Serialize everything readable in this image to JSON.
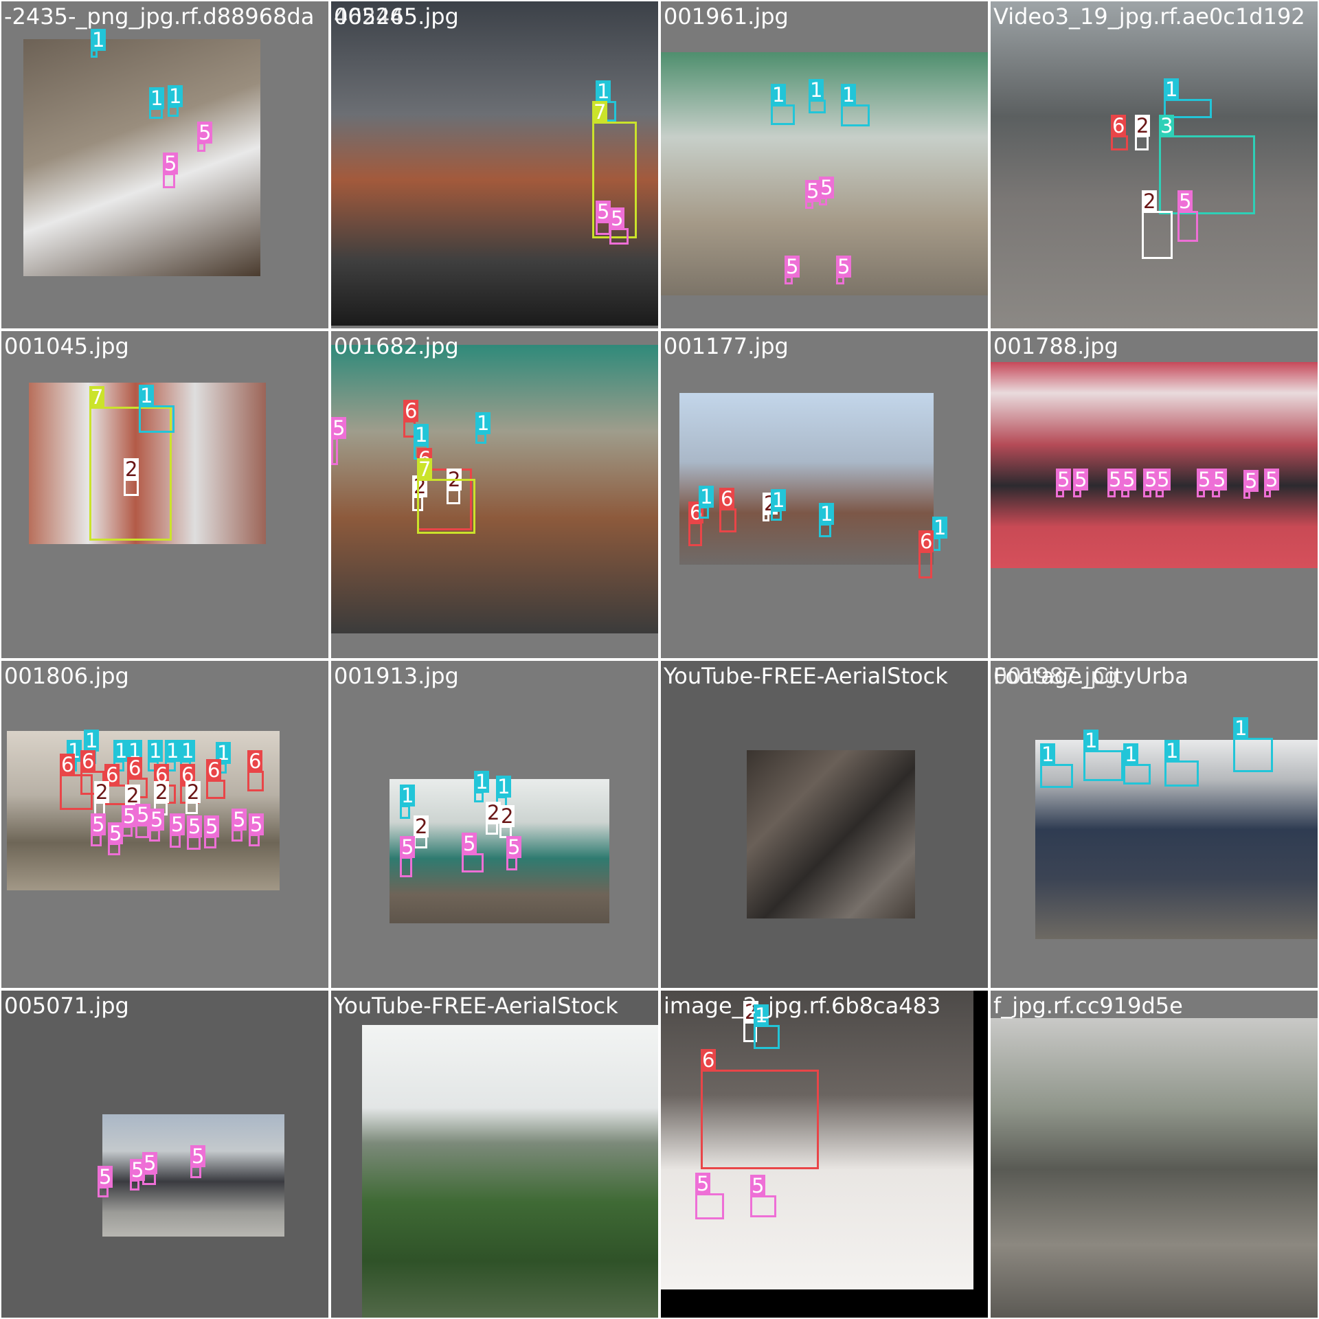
{
  "tiles": [
    {
      "label": "-2435-_png_jpg.rf.d88968da",
      "bg": "#7a7a7a",
      "photo": {
        "bg": "linear-gradient(160deg,#6d6256 0%,#9a8e7e 40%,#e9e9e9 60%,#4a3b2e 100%)"
      },
      "boxes": [
        {
          "cls": "1",
          "color": "#22c5d8",
          "text": "#ffffff"
        },
        {
          "cls": "1",
          "color": "#22c5d8",
          "text": "#ffffff"
        },
        {
          "cls": "1",
          "color": "#22c5d8",
          "text": "#ffffff"
        },
        {
          "cls": "5",
          "color": "#ee6fd6",
          "text": "#ffffff"
        },
        {
          "cls": "5",
          "color": "#ee6fd6",
          "text": "#ffffff"
        }
      ]
    },
    {
      "label": "005265.jpg",
      "bg": "#7a7a7a",
      "label2": "46244",
      "photo": {
        "bg": "linear-gradient(180deg,#3c4148 0%,#6c6f74 35%,#a35a3c 55%,#3f3f3f 80%,#1b1b1b 100%)"
      },
      "boxes": [
        {
          "cls": "1",
          "color": "#22c5d8",
          "text": "#ffffff"
        },
        {
          "cls": "7",
          "color": "#cbe32b",
          "text": "#ffffff"
        },
        {
          "cls": "5",
          "color": "#ee6fd6",
          "text": "#ffffff"
        },
        {
          "cls": "5",
          "color": "#ee6fd6",
          "text": "#ffffff"
        }
      ]
    },
    {
      "label": "001961.jpg",
      "bg": "#7a7a7a",
      "photo": {
        "bg": "linear-gradient(180deg,#4f8f6e 0%,#c7cfc9 35%,#a59a88 70%,#7c7468 100%)"
      },
      "boxes": [
        {
          "cls": "1",
          "color": "#22c5d8",
          "text": "#ffffff"
        },
        {
          "cls": "1",
          "color": "#22c5d8",
          "text": "#ffffff"
        },
        {
          "cls": "1",
          "color": "#22c5d8",
          "text": "#ffffff"
        },
        {
          "cls": "5",
          "color": "#ee6fd6",
          "text": "#ffffff"
        },
        {
          "cls": "5",
          "color": "#ee6fd6",
          "text": "#ffffff"
        },
        {
          "cls": "5",
          "color": "#ee6fd6",
          "text": "#ffffff"
        },
        {
          "cls": "5",
          "color": "#ee6fd6",
          "text": "#ffffff"
        }
      ]
    },
    {
      "label": "Video3_19_jpg.rf.ae0c1d192",
      "bg": "#7a7a7a",
      "photo": {
        "bg": "linear-gradient(180deg,#9ea4a7 0%,#5b5f60 35%,#7a7775 60%,#8c8985 100%)"
      },
      "boxes": [
        {
          "cls": "1",
          "color": "#22c5d8",
          "text": "#ffffff"
        },
        {
          "cls": "3",
          "color": "#2ed0b7",
          "text": "#ffffff"
        },
        {
          "cls": "6",
          "color": "#e94548",
          "text": "#ffffff"
        },
        {
          "cls": "2",
          "color": "#ffffff",
          "text": "#6a1616"
        },
        {
          "cls": "2",
          "color": "#ffffff",
          "text": "#6a1616"
        },
        {
          "cls": "5",
          "color": "#ee6fd6",
          "text": "#ffffff"
        },
        {
          "cls": "5",
          "color": "#ee6fd6",
          "text": "#ffffff"
        }
      ]
    },
    {
      "label": "001045.jpg",
      "bg": "#7a7a7a",
      "photo": {
        "bg": "linear-gradient(90deg,#b86f5b 0%,#e6e6e6 25%,#b35a47 45%,#dedede 70%,#9c6457 100%)"
      },
      "boxes": [
        {
          "cls": "7",
          "color": "#cbe32b",
          "text": "#ffffff"
        },
        {
          "cls": "1",
          "color": "#22c5d8",
          "text": "#ffffff"
        },
        {
          "cls": "2",
          "color": "#ffffff",
          "text": "#6a1616"
        }
      ]
    },
    {
      "label": "001682.jpg",
      "bg": "#7a7a7a",
      "photo": {
        "bg": "linear-gradient(180deg,#2f8a7a 0%,#9f9d8c 30%,#8d5a3c 60%,#3b3b3b 100%)"
      },
      "boxes": [
        {
          "cls": "5",
          "color": "#ee6fd6",
          "text": "#ffffff"
        },
        {
          "cls": "6",
          "color": "#e94548",
          "text": "#ffffff"
        },
        {
          "cls": "1",
          "color": "#22c5d8",
          "text": "#ffffff"
        },
        {
          "cls": "1",
          "color": "#22c5d8",
          "text": "#ffffff"
        },
        {
          "cls": "6",
          "color": "#e94548",
          "text": "#ffffff"
        },
        {
          "cls": "2",
          "color": "#ffffff",
          "text": "#6a1616"
        },
        {
          "cls": "2",
          "color": "#ffffff",
          "text": "#6a1616"
        },
        {
          "cls": "7",
          "color": "#cbe32b",
          "text": "#ffffff"
        }
      ]
    },
    {
      "label": "001177.jpg",
      "bg": "#7a7a7a",
      "photo": {
        "bg": "linear-gradient(180deg,#c3d6ea 0%,#aab8c8 40%,#7c5747 70%,#6f6b69 100%)"
      },
      "boxes": [
        {
          "cls": "6",
          "color": "#e94548",
          "text": "#ffffff"
        },
        {
          "cls": "1",
          "color": "#22c5d8",
          "text": "#ffffff"
        },
        {
          "cls": "6",
          "color": "#e94548",
          "text": "#ffffff"
        },
        {
          "cls": "2",
          "color": "#ffffff",
          "text": "#6a1616"
        },
        {
          "cls": "1",
          "color": "#22c5d8",
          "text": "#ffffff"
        },
        {
          "cls": "1",
          "color": "#22c5d8",
          "text": "#ffffff"
        },
        {
          "cls": "1",
          "color": "#22c5d8",
          "text": "#ffffff"
        },
        {
          "cls": "6",
          "color": "#e94548",
          "text": "#ffffff"
        }
      ]
    },
    {
      "label": "001788.jpg",
      "bg": "#7a7a7a",
      "photo": {
        "bg": "linear-gradient(180deg,#c6495a 0%,#e9dbdd 15%,#b54b57 40%,#2c2a2f 60%,#c94a55 80%,#d6505b 100%)"
      },
      "boxes": [
        {
          "cls": "5",
          "color": "#ee6fd6",
          "text": "#ffffff"
        },
        {
          "cls": "5",
          "color": "#ee6fd6",
          "text": "#ffffff"
        },
        {
          "cls": "5",
          "color": "#ee6fd6",
          "text": "#ffffff"
        },
        {
          "cls": "5",
          "color": "#ee6fd6",
          "text": "#ffffff"
        },
        {
          "cls": "5",
          "color": "#ee6fd6",
          "text": "#ffffff"
        },
        {
          "cls": "5",
          "color": "#ee6fd6",
          "text": "#ffffff"
        },
        {
          "cls": "5",
          "color": "#ee6fd6",
          "text": "#ffffff"
        },
        {
          "cls": "5",
          "color": "#ee6fd6",
          "text": "#ffffff"
        },
        {
          "cls": "5",
          "color": "#ee6fd6",
          "text": "#ffffff"
        },
        {
          "cls": "5",
          "color": "#ee6fd6",
          "text": "#ffffff"
        }
      ]
    },
    {
      "label": "001806.jpg",
      "bg": "#7a7a7a",
      "photo": {
        "bg": "linear-gradient(180deg,#d9d2c8 0%,#b8b1a6 40%,#6e6657 70%,#a29887 100%)"
      },
      "boxes": [
        {
          "cls": "1",
          "color": "#22c5d8",
          "text": "#ffffff"
        },
        {
          "cls": "1",
          "color": "#22c5d8",
          "text": "#ffffff"
        },
        {
          "cls": "1",
          "color": "#22c5d8",
          "text": "#ffffff"
        },
        {
          "cls": "1",
          "color": "#22c5d8",
          "text": "#ffffff"
        },
        {
          "cls": "1",
          "color": "#22c5d8",
          "text": "#ffffff"
        },
        {
          "cls": "1",
          "color": "#22c5d8",
          "text": "#ffffff"
        },
        {
          "cls": "1",
          "color": "#22c5d8",
          "text": "#ffffff"
        },
        {
          "cls": "1",
          "color": "#22c5d8",
          "text": "#ffffff"
        },
        {
          "cls": "6",
          "color": "#e94548",
          "text": "#ffffff"
        },
        {
          "cls": "6",
          "color": "#e94548",
          "text": "#ffffff"
        },
        {
          "cls": "6",
          "color": "#e94548",
          "text": "#ffffff"
        },
        {
          "cls": "6",
          "color": "#e94548",
          "text": "#ffffff"
        },
        {
          "cls": "6",
          "color": "#e94548",
          "text": "#ffffff"
        },
        {
          "cls": "6",
          "color": "#e94548",
          "text": "#ffffff"
        },
        {
          "cls": "6",
          "color": "#e94548",
          "text": "#ffffff"
        },
        {
          "cls": "6",
          "color": "#e94548",
          "text": "#ffffff"
        },
        {
          "cls": "2",
          "color": "#ffffff",
          "text": "#6a1616"
        },
        {
          "cls": "2",
          "color": "#ffffff",
          "text": "#6a1616"
        },
        {
          "cls": "2",
          "color": "#ffffff",
          "text": "#6a1616"
        },
        {
          "cls": "2",
          "color": "#ffffff",
          "text": "#6a1616"
        },
        {
          "cls": "5",
          "color": "#ee6fd6",
          "text": "#ffffff"
        },
        {
          "cls": "5",
          "color": "#ee6fd6",
          "text": "#ffffff"
        },
        {
          "cls": "5",
          "color": "#ee6fd6",
          "text": "#ffffff"
        },
        {
          "cls": "5",
          "color": "#ee6fd6",
          "text": "#ffffff"
        },
        {
          "cls": "5",
          "color": "#ee6fd6",
          "text": "#ffffff"
        },
        {
          "cls": "5",
          "color": "#ee6fd6",
          "text": "#ffffff"
        },
        {
          "cls": "5",
          "color": "#ee6fd6",
          "text": "#ffffff"
        },
        {
          "cls": "5",
          "color": "#ee6fd6",
          "text": "#ffffff"
        },
        {
          "cls": "5",
          "color": "#ee6fd6",
          "text": "#ffffff"
        },
        {
          "cls": "5",
          "color": "#ee6fd6",
          "text": "#ffffff"
        }
      ]
    },
    {
      "label": "001913.jpg",
      "bg": "#7a7a7a",
      "photo": {
        "bg": "linear-gradient(180deg,#e9eceb 0%,#cdd4d1 30%,#2f7b70 55%,#6f6458 80%,#5e554b 100%)"
      },
      "boxes": [
        {
          "cls": "1",
          "color": "#22c5d8",
          "text": "#ffffff"
        },
        {
          "cls": "1",
          "color": "#22c5d8",
          "text": "#ffffff"
        },
        {
          "cls": "1",
          "color": "#22c5d8",
          "text": "#ffffff"
        },
        {
          "cls": "2",
          "color": "#ffffff",
          "text": "#6a1616"
        },
        {
          "cls": "2",
          "color": "#ffffff",
          "text": "#6a1616"
        },
        {
          "cls": "2",
          "color": "#ffffff",
          "text": "#6a1616"
        },
        {
          "cls": "5",
          "color": "#ee6fd6",
          "text": "#ffffff"
        },
        {
          "cls": "5",
          "color": "#ee6fd6",
          "text": "#ffffff"
        },
        {
          "cls": "5",
          "color": "#ee6fd6",
          "text": "#ffffff"
        }
      ]
    },
    {
      "label": "YouTube-FREE-AerialStock",
      "bg": "#5e5e5e",
      "photo": {
        "bg": "linear-gradient(135deg,#3a342f 0%,#6a6058 30%,#2d2a28 55%,#77706a 80%,#453e38 100%)"
      },
      "boxes": []
    },
    {
      "label": "Footage_CityUrba",
      "bg": "#7a7a7a",
      "label2": "001987.jpg",
      "photo": {
        "bg": "linear-gradient(180deg,#e8e9ea 0%,#b6b9bc 20%,#2f3c52 45%,#3c4454 70%,#6e6a63 100%)"
      },
      "boxes": [
        {
          "cls": "1",
          "color": "#22c5d8",
          "text": "#ffffff"
        },
        {
          "cls": "1",
          "color": "#22c5d8",
          "text": "#ffffff"
        },
        {
          "cls": "1",
          "color": "#22c5d8",
          "text": "#ffffff"
        },
        {
          "cls": "1",
          "color": "#22c5d8",
          "text": "#ffffff"
        },
        {
          "cls": "1",
          "color": "#22c5d8",
          "text": "#ffffff"
        }
      ]
    },
    {
      "label": "005071.jpg",
      "bg": "#5e5e5e",
      "photo": {
        "bg": "linear-gradient(180deg,#aab7c6 0%,#c4c9cc 30%,#3a3b40 55%,#9b9b97 80%,#b8b7b2 100%)"
      },
      "boxes": [
        {
          "cls": "5",
          "color": "#ee6fd6",
          "text": "#ffffff"
        },
        {
          "cls": "5",
          "color": "#ee6fd6",
          "text": "#ffffff"
        },
        {
          "cls": "5",
          "color": "#ee6fd6",
          "text": "#ffffff"
        },
        {
          "cls": "5",
          "color": "#ee6fd6",
          "text": "#ffffff"
        }
      ]
    },
    {
      "label": "YouTube-FREE-AerialStock",
      "bg": "#5e5e5e",
      "photo": {
        "bg": "linear-gradient(180deg,#f2f4f3 0%,#e3e6e6 28%,#7c8a7a 40%,#3f6a35 60%,#2f5228 80%,#546a4a 100%)"
      },
      "boxes": []
    },
    {
      "label": "image_2_jpg.rf.6b8ca483",
      "bg": "#000000",
      "photo": {
        "bg": "linear-gradient(180deg,#4d4a48 0%,#6b6561 35%,#e9e6e3 60%,#f4f2f0 100%)"
      },
      "boxes": [
        {
          "cls": "2",
          "color": "#ffffff",
          "text": "#6a1616"
        },
        {
          "cls": "1",
          "color": "#22c5d8",
          "text": "#ffffff"
        },
        {
          "cls": "6",
          "color": "#e94548",
          "text": "#ffffff"
        },
        {
          "cls": "5",
          "color": "#ee6fd6",
          "text": "#ffffff"
        },
        {
          "cls": "5",
          "color": "#ee6fd6",
          "text": "#ffffff"
        }
      ]
    },
    {
      "label": "f_jpg.rf.cc919d5e",
      "bg": "#7a7a7a",
      "photo": {
        "bg": "linear-gradient(180deg,#c9c9c7 0%,#8f958a 30%,#595a54 50%,#8c8880 75%,#5a5853 100%)"
      },
      "boxes": []
    }
  ]
}
